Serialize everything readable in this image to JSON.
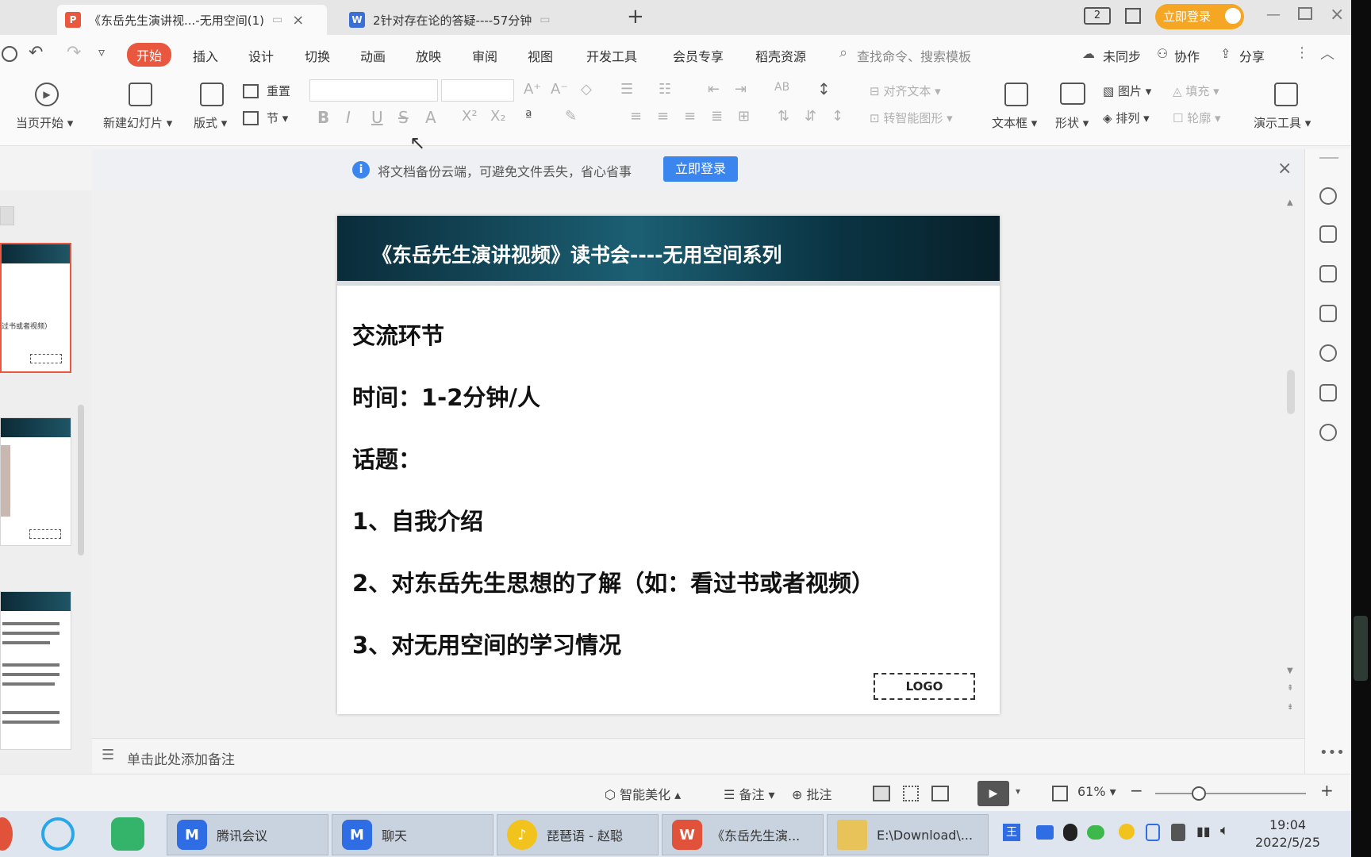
{
  "tabs": [
    {
      "label": "《东岳先生演讲视...-无用空间(1)",
      "icon": "presentation-icon",
      "close": "×"
    },
    {
      "label": "2针对存在论的答疑----57分钟",
      "icon": "document-icon"
    }
  ],
  "tabbar": {
    "new_tab": "+",
    "login_button": "立即登录",
    "page_indicator": "2"
  },
  "menu": [
    "开始",
    "插入",
    "设计",
    "切换",
    "动画",
    "放映",
    "审阅",
    "视图",
    "开发工具",
    "会员专享",
    "稻壳资源"
  ],
  "search_placeholder": "查找命令、搜索模板",
  "menu_right": {
    "sync": "未同步",
    "collab": "协作",
    "share": "分享"
  },
  "ribbon": {
    "play_from_current": "当页开始",
    "new_slide": "新建幻灯片",
    "layout": "版式",
    "reset": "重置",
    "section": "节",
    "align_text": "对齐文本",
    "smart_art": "转智能图形",
    "text_box": "文本框",
    "shape": "形状",
    "picture": "图片",
    "fill": "填充",
    "arrange": "排列",
    "outline": "轮廓",
    "present_tools": "演示工具",
    "font_buttons": [
      "B",
      "I",
      "U",
      "S",
      "A",
      "X²",
      "X₂"
    ]
  },
  "infobar": {
    "message": "将文档备份云端，可避免文件丢失，省心省事",
    "button": "立即登录"
  },
  "slide": {
    "title": "《东岳先生演讲视频》读书会----无用空间系列",
    "lines": [
      "交流环节",
      "时间：1-2分钟/人",
      "话题：",
      "1、自我介绍",
      "2、对东岳先生思想的了解（如：看过书或者视频）",
      "3、对无用空间的学习情况"
    ],
    "logo": "LOGO"
  },
  "thumbnails": {
    "thumb1_text": "过书或者视频）"
  },
  "notes_placeholder": "单击此处添加备注",
  "statusbar": {
    "beautify": "智能美化",
    "notes": "备注",
    "comment": "批注",
    "zoom": "61%",
    "zoom_minus": "−",
    "zoom_plus": "+"
  },
  "taskbar": {
    "items": [
      "腾讯会议",
      "聊天",
      "琵琶语 - 赵聪",
      "《东岳先生演...",
      "E:\\Download\\..."
    ],
    "time": "19:04",
    "date": "2022/5/25"
  },
  "colors": {
    "accent": "#e9573f",
    "login_orange": "#f5a623",
    "blue_button": "#3a86ee"
  }
}
